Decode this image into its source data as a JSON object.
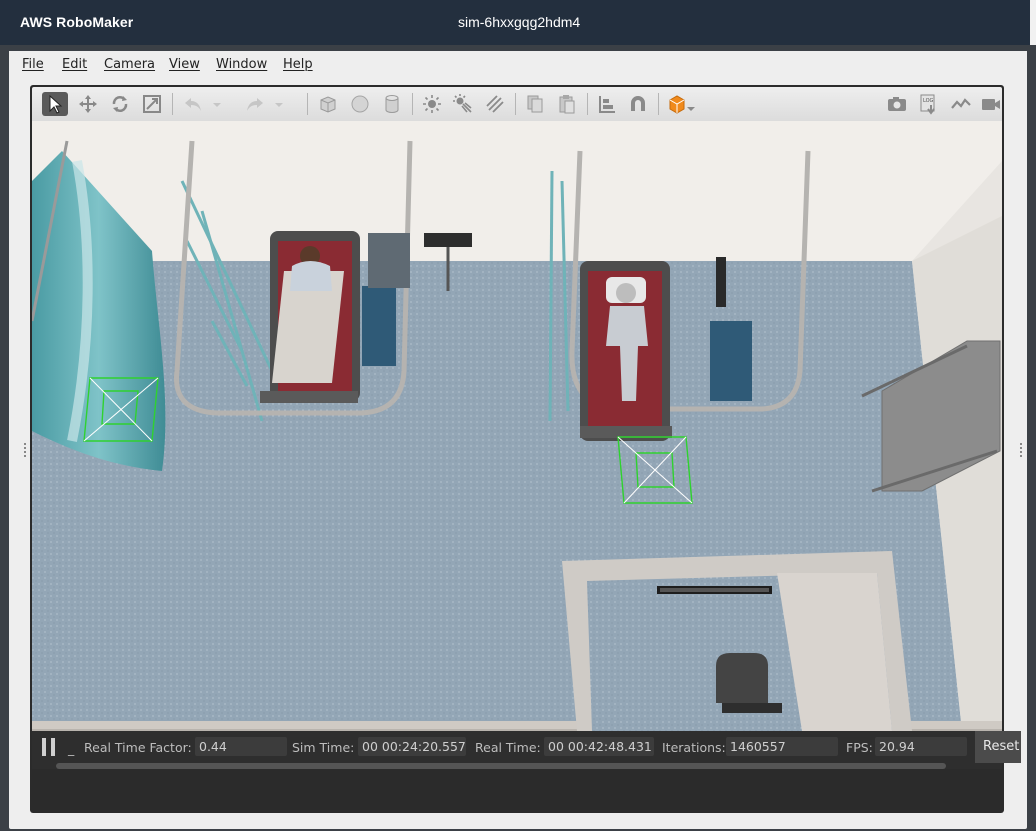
{
  "app": {
    "brand": "AWS RoboMaker",
    "simulation_name": "sim-6hxxgqg2hdm4"
  },
  "menu": [
    {
      "id": "file",
      "label": "File"
    },
    {
      "id": "edit",
      "label": "Edit"
    },
    {
      "id": "camera",
      "label": "Camera"
    },
    {
      "id": "view",
      "label": "View"
    },
    {
      "id": "window",
      "label": "Window"
    },
    {
      "id": "help",
      "label": "Help"
    }
  ],
  "toolbar": {
    "tools": [
      {
        "icon": "select-arrow-icon",
        "active": true
      },
      {
        "icon": "translate-icon"
      },
      {
        "icon": "rotate-icon"
      },
      {
        "icon": "scale-icon"
      },
      {
        "icon": "undo-icon"
      },
      {
        "icon": "undo-dropdown-icon"
      },
      {
        "icon": "redo-icon"
      },
      {
        "icon": "redo-dropdown-icon"
      },
      {
        "icon": "box-shape-icon"
      },
      {
        "icon": "sphere-shape-icon"
      },
      {
        "icon": "cylinder-shape-icon"
      },
      {
        "icon": "point-light-icon"
      },
      {
        "icon": "spot-light-icon"
      },
      {
        "icon": "directional-light-icon"
      },
      {
        "icon": "copy-icon"
      },
      {
        "icon": "paste-icon"
      },
      {
        "icon": "align-icon"
      },
      {
        "icon": "snap-magnet-icon"
      },
      {
        "icon": "view-angle-icon"
      },
      {
        "icon": "screenshot-camera-icon"
      },
      {
        "icon": "log-icon"
      },
      {
        "icon": "plot-icon"
      },
      {
        "icon": "video-record-icon"
      }
    ]
  },
  "status": {
    "real_time_factor_label": "Real Time Factor:",
    "real_time_factor": "0.44",
    "sim_time_label": "Sim Time:",
    "sim_time": "00 00:24:20.557",
    "real_time_label": "Real Time:",
    "real_time": "00 00:42:48.431",
    "iterations_label": "Iterations:",
    "iterations": "1460557",
    "fps_label": "FPS:",
    "fps": "20.94",
    "reset_label": "Reset",
    "step_label": "_"
  },
  "colors": {
    "topbar": "#232f3e",
    "floor": "#8fa2b2",
    "bed": "#8a2b33",
    "curtain": "#4c9aa2",
    "selection": "#33cc33"
  }
}
